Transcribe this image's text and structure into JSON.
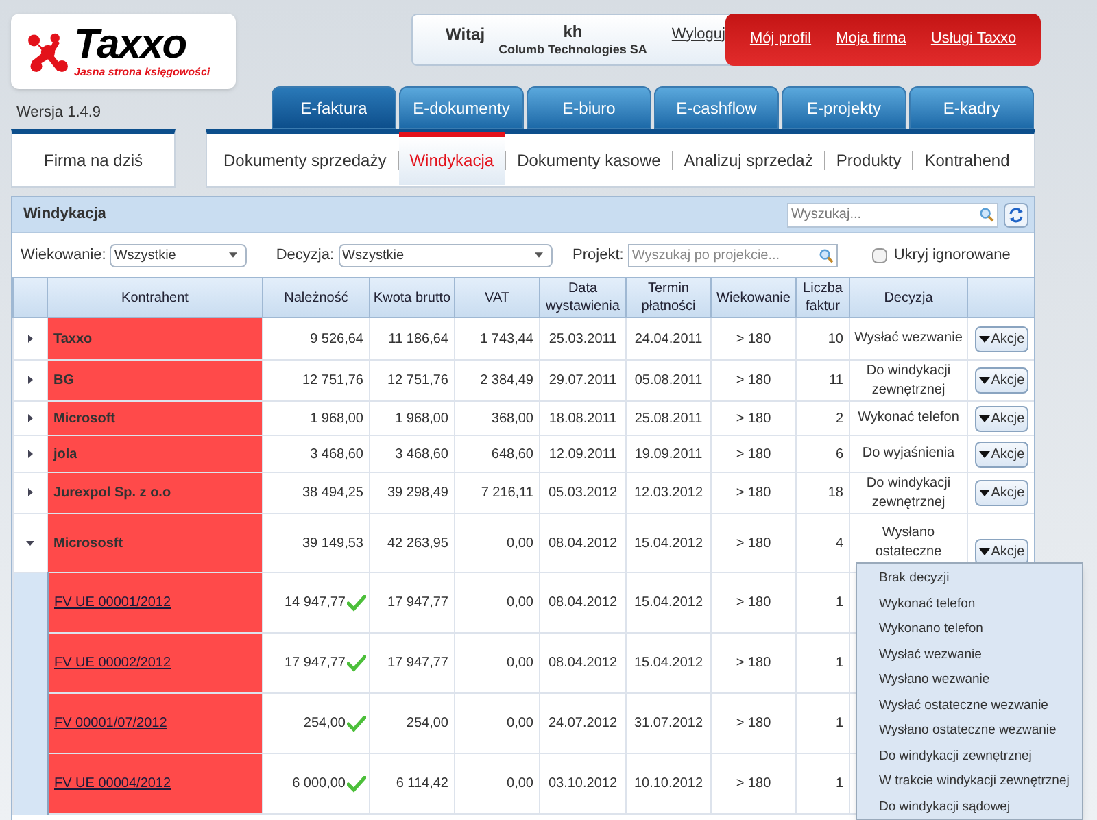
{
  "logo": {
    "name": "Taxxo",
    "tagline": "Jasna strona księgowości"
  },
  "version": "Wersja 1.4.9",
  "user_box": {
    "greeting": "Witaj",
    "user": "kh",
    "company": "Columb Technologies SA",
    "logout": "Wyloguj"
  },
  "top_links": [
    "Mój profil",
    "Moja firma",
    "Usługi Taxxo"
  ],
  "tabs": [
    {
      "label": "E-faktura",
      "selected": true
    },
    {
      "label": "E-dokumenty",
      "selected": false
    },
    {
      "label": "E-biuro",
      "selected": false
    },
    {
      "label": "E-cashflow",
      "selected": false
    },
    {
      "label": "E-projekty",
      "selected": false
    },
    {
      "label": "E-kadry",
      "selected": false
    }
  ],
  "side_button": "Firma na dziś",
  "subtabs": [
    {
      "label": "Dokumenty sprzedaży",
      "selected": false
    },
    {
      "label": "Windykacja",
      "selected": true
    },
    {
      "label": "Dokumenty kasowe",
      "selected": false
    },
    {
      "label": "Analizuj sprzedaż",
      "selected": false
    },
    {
      "label": "Produkty",
      "selected": false
    },
    {
      "label": "Kontrahend",
      "selected": false
    }
  ],
  "panel": {
    "title": "Windykacja",
    "search": {
      "placeholder": "Wyszukaj..."
    },
    "filters": {
      "aging_label": "Wiekowanie:",
      "aging_value": "Wszystkie",
      "decision_label": "Decyzja:",
      "decision_value": "Wszystkie",
      "project_label": "Projekt:",
      "project_placeholder": "Wyszukaj po projekcie...",
      "hide_label": "Ukryj ignorowane",
      "hide_checked": false
    }
  },
  "table": {
    "columns": [
      "Kontrahent",
      "Należność",
      "Kwota brutto",
      "VAT",
      "Data wystawienia",
      "Termin płatności",
      "Wiekowanie",
      "Liczba faktur",
      "Decyzja"
    ],
    "rows": [
      {
        "name": "Taxxo",
        "receivable": "9 526,64",
        "gross": "11 186,64",
        "vat": "1 743,44",
        "issued": "25.03.2011",
        "due": "24.04.2011",
        "aging": "> 180",
        "count": "10",
        "decision": "Wysłać wezwanie",
        "action": "Akcje",
        "expanded": false
      },
      {
        "name": "BG",
        "receivable": "12 751,76",
        "gross": "12 751,76",
        "vat": "2 384,49",
        "issued": "29.07.2011",
        "due": "05.08.2011",
        "aging": "> 180",
        "count": "11",
        "decision": "Do windykacji zewnętrznej",
        "action": "Akcje",
        "expanded": false
      },
      {
        "name": "Microsoft",
        "receivable": "1 968,00",
        "gross": "1 968,00",
        "vat": "368,00",
        "issued": "18.08.2011",
        "due": "25.08.2011",
        "aging": "> 180",
        "count": "2",
        "decision": "Wykonać telefon",
        "action": "Akcje",
        "expanded": false
      },
      {
        "name": "jola",
        "receivable": "3 468,60",
        "gross": "3 468,60",
        "vat": "648,60",
        "issued": "12.09.2011",
        "due": "19.09.2011",
        "aging": "> 180",
        "count": "6",
        "decision": "Do wyjaśnienia",
        "action": "Akcje",
        "expanded": false
      },
      {
        "name": "Jurexpol Sp. z o.o",
        "receivable": "38 494,25",
        "gross": "39 298,49",
        "vat": "7 216,11",
        "issued": "05.03.2012",
        "due": "12.03.2012",
        "aging": "> 180",
        "count": "18",
        "decision": "Do windykacji zewnętrznej",
        "action": "Akcje",
        "expanded": false
      },
      {
        "name": "Micrososft",
        "receivable": "39 149,53",
        "gross": "42 263,95",
        "vat": "0,00",
        "issued": "08.04.2012",
        "due": "15.04.2012",
        "aging": "> 180",
        "count": "4",
        "decision": "Wysłano ostateczne",
        "action": "Akcje",
        "expanded": true,
        "children": [
          {
            "name": "FV UE 00001/2012",
            "receivable": "14 947,77",
            "paid": true,
            "gross": "17 947,77",
            "vat": "0,00",
            "issued": "08.04.2012",
            "due": "15.04.2012",
            "aging": "> 180",
            "count": "1"
          },
          {
            "name": "FV UE 00002/2012",
            "receivable": "17 947,77",
            "paid": true,
            "gross": "17 947,77",
            "vat": "0,00",
            "issued": "08.04.2012",
            "due": "15.04.2012",
            "aging": "> 180",
            "count": "1"
          },
          {
            "name": "FV 00001/07/2012",
            "receivable": "254,00",
            "paid": true,
            "gross": "254,00",
            "vat": "0,00",
            "issued": "24.07.2012",
            "due": "31.07.2012",
            "aging": "> 180",
            "count": "1"
          },
          {
            "name": "FV UE 00004/2012",
            "receivable": "6 000,00",
            "paid": true,
            "gross": "6 114,42",
            "vat": "0,00",
            "issued": "03.10.2012",
            "due": "10.10.2012",
            "aging": "> 180",
            "count": "1"
          }
        ]
      }
    ]
  },
  "menu": {
    "items": [
      "Brak decyzji",
      "Wykonać telefon",
      "Wykonano telefon",
      "Wysłać wezwanie",
      "Wysłano wezwanie",
      "Wysłać ostateczne wezwanie",
      "Wysłano ostateczne wezwanie",
      "Do windykacji zewnętrznej",
      "W trakcie windykacji zewnętrznej",
      "Do windykacji sądowej"
    ]
  }
}
